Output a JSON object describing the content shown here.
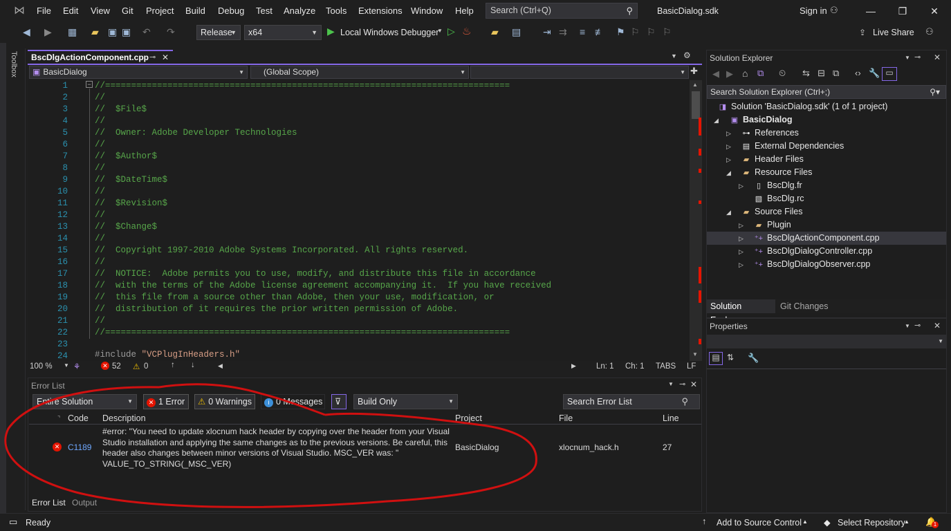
{
  "menu": [
    "File",
    "Edit",
    "View",
    "Git",
    "Project",
    "Build",
    "Debug",
    "Test",
    "Analyze",
    "Tools",
    "Extensions",
    "Window",
    "Help"
  ],
  "search": {
    "placeholder": "Search (Ctrl+Q)"
  },
  "window_title": "BasicDialog.sdk",
  "sign_in": "Sign in",
  "toolbar": {
    "config": "Release",
    "platform": "x64",
    "debugger": "Local Windows Debugger",
    "live_share": "Live Share"
  },
  "toolbox_label": "Toolbox",
  "editor": {
    "tab": "BscDlgActionComponent.cpp",
    "nav_project": "BasicDialog",
    "nav_scope": "(Global Scope)",
    "lines": [
      {
        "n": "1",
        "t": "//=============================================================================="
      },
      {
        "n": "2",
        "t": "//"
      },
      {
        "n": "3",
        "t": "//  $File$"
      },
      {
        "n": "4",
        "t": "//"
      },
      {
        "n": "5",
        "t": "//  Owner: Adobe Developer Technologies"
      },
      {
        "n": "6",
        "t": "//"
      },
      {
        "n": "7",
        "t": "//  $Author$"
      },
      {
        "n": "8",
        "t": "//"
      },
      {
        "n": "9",
        "t": "//  $DateTime$"
      },
      {
        "n": "10",
        "t": "//"
      },
      {
        "n": "11",
        "t": "//  $Revision$"
      },
      {
        "n": "12",
        "t": "//"
      },
      {
        "n": "13",
        "t": "//  $Change$"
      },
      {
        "n": "14",
        "t": "//"
      },
      {
        "n": "15",
        "t": "//  Copyright 1997-2010 Adobe Systems Incorporated. All rights reserved."
      },
      {
        "n": "16",
        "t": "//"
      },
      {
        "n": "17",
        "t": "//  NOTICE:  Adobe permits you to use, modify, and distribute this file in accordance"
      },
      {
        "n": "18",
        "t": "//  with the terms of the Adobe license agreement accompanying it.  If you have received"
      },
      {
        "n": "19",
        "t": "//  this file from a source other than Adobe, then your use, modification, or"
      },
      {
        "n": "20",
        "t": "//  distribution of it requires the prior written permission of Adobe."
      },
      {
        "n": "21",
        "t": "//"
      },
      {
        "n": "22",
        "t": "//=============================================================================="
      },
      {
        "n": "23",
        "t": ""
      },
      {
        "n": "24",
        "t": ""
      }
    ],
    "include_kw": "#include ",
    "include_file": "\"VCPlugInHeaders.h\"",
    "status": {
      "zoom": "100 %",
      "errors": "52",
      "warnings": "0",
      "ln": "Ln: 1",
      "ch": "Ch: 1",
      "tabs": "TABS",
      "eol": "LF"
    }
  },
  "error_list": {
    "title": "Error List",
    "scope": "Entire Solution",
    "errors_btn": "1 Error",
    "warnings_btn": "0 Warnings",
    "messages_btn": "0 Messages",
    "build_filter": "Build Only",
    "search_placeholder": "Search Error List",
    "columns": {
      "code": "Code",
      "description": "Description",
      "project": "Project",
      "file": "File",
      "line": "Line"
    },
    "rows": [
      {
        "code": "C1189",
        "description": [
          "#error:  \"You need to update xlocnum hack header by copying over the header from your Visual",
          "Studio installation and applying the same changes as to the previous versions. Be careful, this",
          "header also changes between minor versions of Visual Studio. MSC_VER was: \"",
          "VALUE_TO_STRING(_MSC_VER)"
        ],
        "project": "BasicDialog",
        "file": "xlocnum_hack.h",
        "line": "27"
      }
    ],
    "bottom_tabs": [
      "Error List",
      "Output"
    ]
  },
  "solution_explorer": {
    "title": "Solution Explorer",
    "search_placeholder": "Search Solution Explorer (Ctrl+;)",
    "solution": "Solution 'BasicDialog.sdk' (1 of 1 project)",
    "project": "BasicDialog",
    "items": [
      "References",
      "External Dependencies",
      "Header Files",
      "Resource Files",
      "BscDlg.fr",
      "BscDlg.rc",
      "Source Files",
      "Plugin",
      "BscDlgActionComponent.cpp",
      "BscDlgDialogController.cpp",
      "BscDlgDialogObserver.cpp"
    ],
    "tabs": [
      "Solution Explorer",
      "Git Changes"
    ]
  },
  "properties": {
    "title": "Properties"
  },
  "statusbar": {
    "ready": "Ready",
    "source_control": "Add to Source Control",
    "repo": "Select Repository",
    "notifications": "1"
  },
  "colors": {
    "accent": "#8568e8",
    "error": "#e51400",
    "annotation": "#d01010"
  }
}
